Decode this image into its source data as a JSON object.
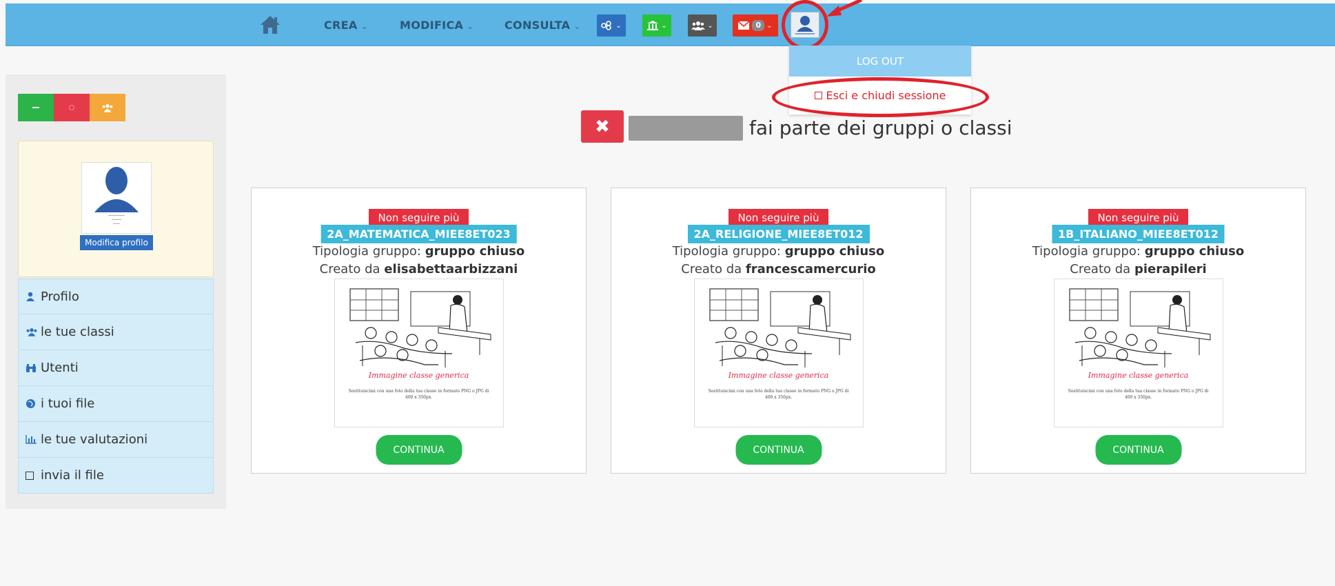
{
  "nav": {
    "menus": [
      {
        "label": "CREA"
      },
      {
        "label": "MODIFICA"
      },
      {
        "label": "CONSULTA"
      }
    ],
    "mail_count": "0",
    "colors": {
      "bar": "#5bb4e4",
      "blue": "#2e6fc0",
      "green": "#29c33a",
      "dark": "#555555",
      "red": "#e4301e"
    }
  },
  "dropdown": {
    "header": "LOG OUT",
    "item": "Esci e chiudi sessione"
  },
  "sidebar": {
    "edit_profile": "Modifica profilo",
    "items": [
      {
        "label": "Profilo",
        "icon": "user-icon"
      },
      {
        "label": "le tue classi",
        "icon": "users-icon"
      },
      {
        "label": "Utenti",
        "icon": "binoculars-icon"
      },
      {
        "label": "i tuoi file",
        "icon": "globe-icon"
      },
      {
        "label": "le tue valutazioni",
        "icon": "bar-chart-icon"
      },
      {
        "label": "invia il file",
        "icon": "square-icon"
      }
    ]
  },
  "main": {
    "heading": "fai parte dei gruppi o classi",
    "cards": [
      {
        "unfollow": "Non seguire più",
        "name": "2A_MATEMATICA_MIEE8ET023",
        "type_prefix": "Tipologia gruppo:",
        "type_value": "gruppo chiuso",
        "creator_prefix": "Creato da",
        "creator": "elisabettaarbizzani",
        "image_title": "Immagine classe generica",
        "image_sub": "Sostituiscimi con una foto della tua classe in formato PNG o JPG di 400 x 350px.",
        "button": "CONTINUA"
      },
      {
        "unfollow": "Non seguire più",
        "name": "2A_RELIGIONE_MIEE8ET012",
        "type_prefix": "Tipologia gruppo:",
        "type_value": "gruppo chiuso",
        "creator_prefix": "Creato da",
        "creator": "francescamercurio",
        "image_title": "Immagine classe generica",
        "image_sub": "Sostituiscimi con una foto della tua classe in formato PNG o JPG di 400 x 350px.",
        "button": "CONTINUA"
      },
      {
        "unfollow": "Non seguire più",
        "name": "1B_ITALIANO_MIEE8ET012",
        "type_prefix": "Tipologia gruppo:",
        "type_value": "gruppo chiuso",
        "creator_prefix": "Creato da",
        "creator": "pierapileri",
        "image_title": "Immagine classe generica",
        "image_sub": "Sostituiscimi con una foto della tua classe in formato PNG o JPG di 400 x 350px.",
        "button": "CONTINUA"
      }
    ]
  }
}
